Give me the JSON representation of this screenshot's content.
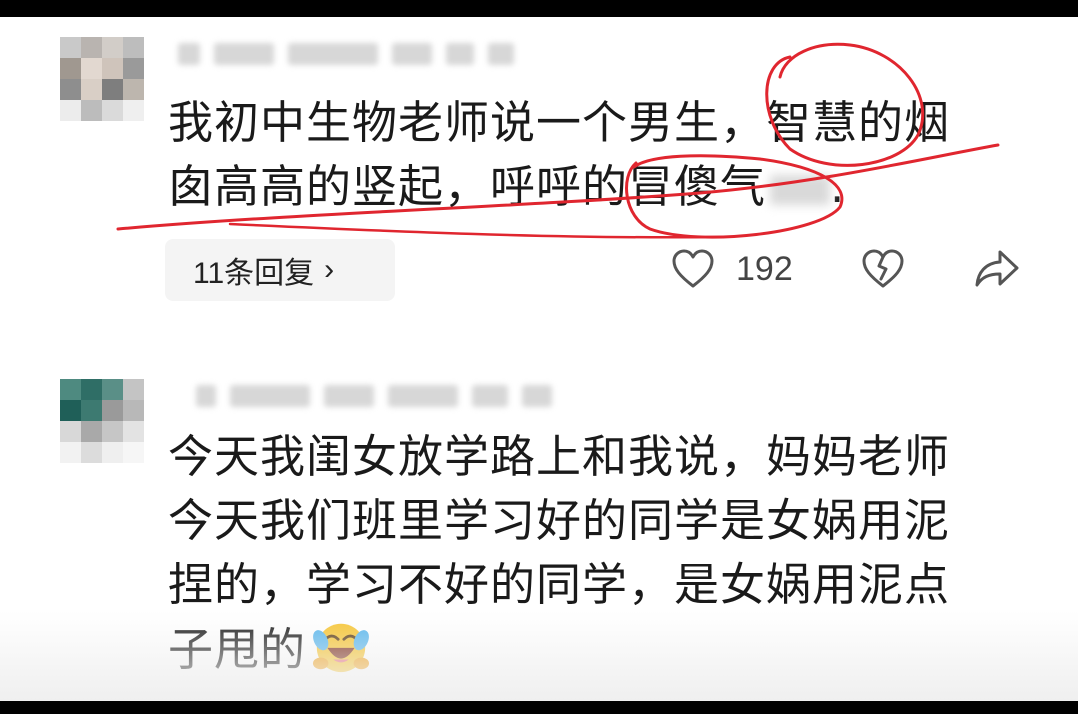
{
  "comments": [
    {
      "text_line1": "我初中生物老师说一个男生，智慧的烟",
      "text_line2": "囱高高的竖起，呼呼的冒傻气",
      "text_tail": ".",
      "replies_label": "11条回复",
      "replies_chevron": "›",
      "like_count": "192",
      "icons": [
        "heart-icon",
        "dislike-broken-heart-icon",
        "share-icon"
      ]
    },
    {
      "text": "今天我闺女放学路上和我说，妈妈老师\n今天我们班里学习好的同学是女娲用泥\n捏的，学习不好的同学，是女娲用泥点\n子甩的",
      "emoji": "laughing-crying-emoji"
    }
  ],
  "colors": {
    "annotation": "#e0262f",
    "text": "#1a1a1a",
    "icon": "#555555"
  }
}
